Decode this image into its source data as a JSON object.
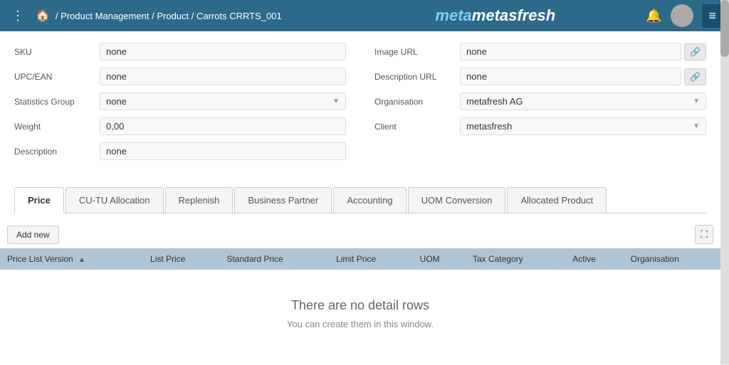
{
  "header": {
    "dots_label": "⋮",
    "home_icon": "🏠",
    "breadcrumb": {
      "separator1": " / ",
      "part1": "Product Management",
      "separator2": " / ",
      "part2": "Product",
      "separator3": " / ",
      "part3": "Carrots CRRTS_001"
    },
    "logo_text": "metasfresh",
    "bell_icon": "🔔",
    "menu_icon": "≡"
  },
  "form": {
    "left": {
      "fields": [
        {
          "label": "SKU",
          "value": "none",
          "type": "text"
        },
        {
          "label": "UPC/EAN",
          "value": "none",
          "type": "text"
        },
        {
          "label": "Statistics Group",
          "value": "none",
          "type": "dropdown"
        },
        {
          "label": "Weight",
          "value": "0,00",
          "type": "text"
        },
        {
          "label": "Description",
          "value": "none",
          "type": "text"
        }
      ]
    },
    "right": {
      "fields": [
        {
          "label": "Image URL",
          "value": "none",
          "type": "link"
        },
        {
          "label": "Description URL",
          "value": "none",
          "type": "link"
        },
        {
          "label": "Organisation",
          "value": "metafresh AG",
          "type": "dropdown"
        },
        {
          "label": "Client",
          "value": "metasfresh",
          "type": "dropdown"
        }
      ]
    }
  },
  "tabs": [
    {
      "id": "price",
      "label": "Price",
      "active": true
    },
    {
      "id": "cu-tu",
      "label": "CU-TU Allocation",
      "active": false
    },
    {
      "id": "replenish",
      "label": "Replenish",
      "active": false
    },
    {
      "id": "business-partner",
      "label": "Business Partner",
      "active": false
    },
    {
      "id": "accounting",
      "label": "Accounting",
      "active": false
    },
    {
      "id": "uom-conversion",
      "label": "UOM Conversion",
      "active": false
    },
    {
      "id": "allocated-product",
      "label": "Allocated Product",
      "active": false
    }
  ],
  "toolbar": {
    "add_new_label": "Add new",
    "expand_icon": "⛶"
  },
  "table": {
    "columns": [
      {
        "id": "price-list-version",
        "label": "Price List Version",
        "sortable": true
      },
      {
        "id": "list-price",
        "label": "List Price",
        "sortable": false
      },
      {
        "id": "standard-price",
        "label": "Standard Price",
        "sortable": false
      },
      {
        "id": "limit-price",
        "label": "Limit Price",
        "sortable": false
      },
      {
        "id": "uom",
        "label": "UOM",
        "sortable": false
      },
      {
        "id": "tax-category",
        "label": "Tax Category",
        "sortable": false
      },
      {
        "id": "active",
        "label": "Active",
        "sortable": false
      },
      {
        "id": "organisation",
        "label": "Organisation",
        "sortable": false
      }
    ],
    "empty_title": "There are no detail rows",
    "empty_subtitle": "You can create them in this window."
  }
}
